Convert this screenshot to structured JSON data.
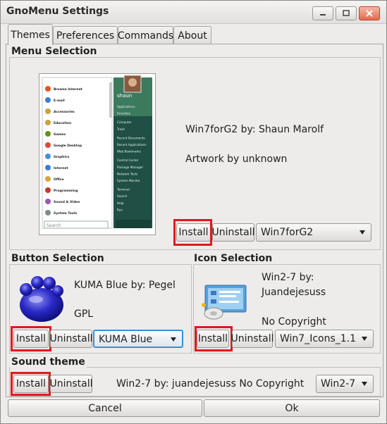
{
  "window": {
    "title": "GnoMenu Settings"
  },
  "tabs": [
    {
      "label": "Themes",
      "active": true
    },
    {
      "label": "Preferences",
      "active": false
    },
    {
      "label": "Commands",
      "active": false
    },
    {
      "label": "About",
      "active": false
    }
  ],
  "menu_selection": {
    "label": "Menu Selection",
    "info_line1": "Win7forG2 by: Shaun Marolf",
    "info_line2": "Artwork by unknown",
    "install": "Install",
    "uninstall": "Uninstall",
    "theme": "Win7forG2",
    "preview": {
      "user": "shaun",
      "left_items": [
        "Browse Internet",
        "E-mail",
        "Accessories",
        "Education",
        "Games",
        "Google Desktop",
        "Graphics",
        "Internet",
        "Office",
        "Programming",
        "Sound & Video",
        "System Tools"
      ],
      "right_items": [
        "Applications",
        "Favorites",
        "Computer",
        "Trash",
        "Recent Documents",
        "Recent Applications",
        "Web Bookmarks",
        "Control Center",
        "Package Manager",
        "Network Tools",
        "System Monitor",
        "Terminal",
        "Search",
        "Help",
        "Run"
      ],
      "search_placeholder": "Search"
    }
  },
  "button_selection": {
    "label": "Button Selection",
    "info_line1": "KUMA Blue by: Pegel",
    "info_line2": "GPL",
    "install": "Install",
    "uninstall": "Uninstall",
    "theme": "KUMA Blue"
  },
  "icon_selection": {
    "label": "Icon Selection",
    "info_line1": "Win2-7 by:",
    "info_line2": "Juandejesuss",
    "info_line3": "No Copyright",
    "install": "Install",
    "uninstall": "Uninstall",
    "theme": "Win7_Icons_1.1"
  },
  "sound_theme": {
    "label": "Sound theme",
    "install": "Install",
    "uninstall": "Uninstall",
    "info": "Win2-7 by: juandejesuss No Copyright",
    "theme": "Win2-7"
  },
  "footer": {
    "cancel": "Cancel",
    "ok": "Ok"
  },
  "colors": {
    "highlight": "#e0191e",
    "focus": "#3b8fd6",
    "preview_menu": "#1f4f45"
  }
}
